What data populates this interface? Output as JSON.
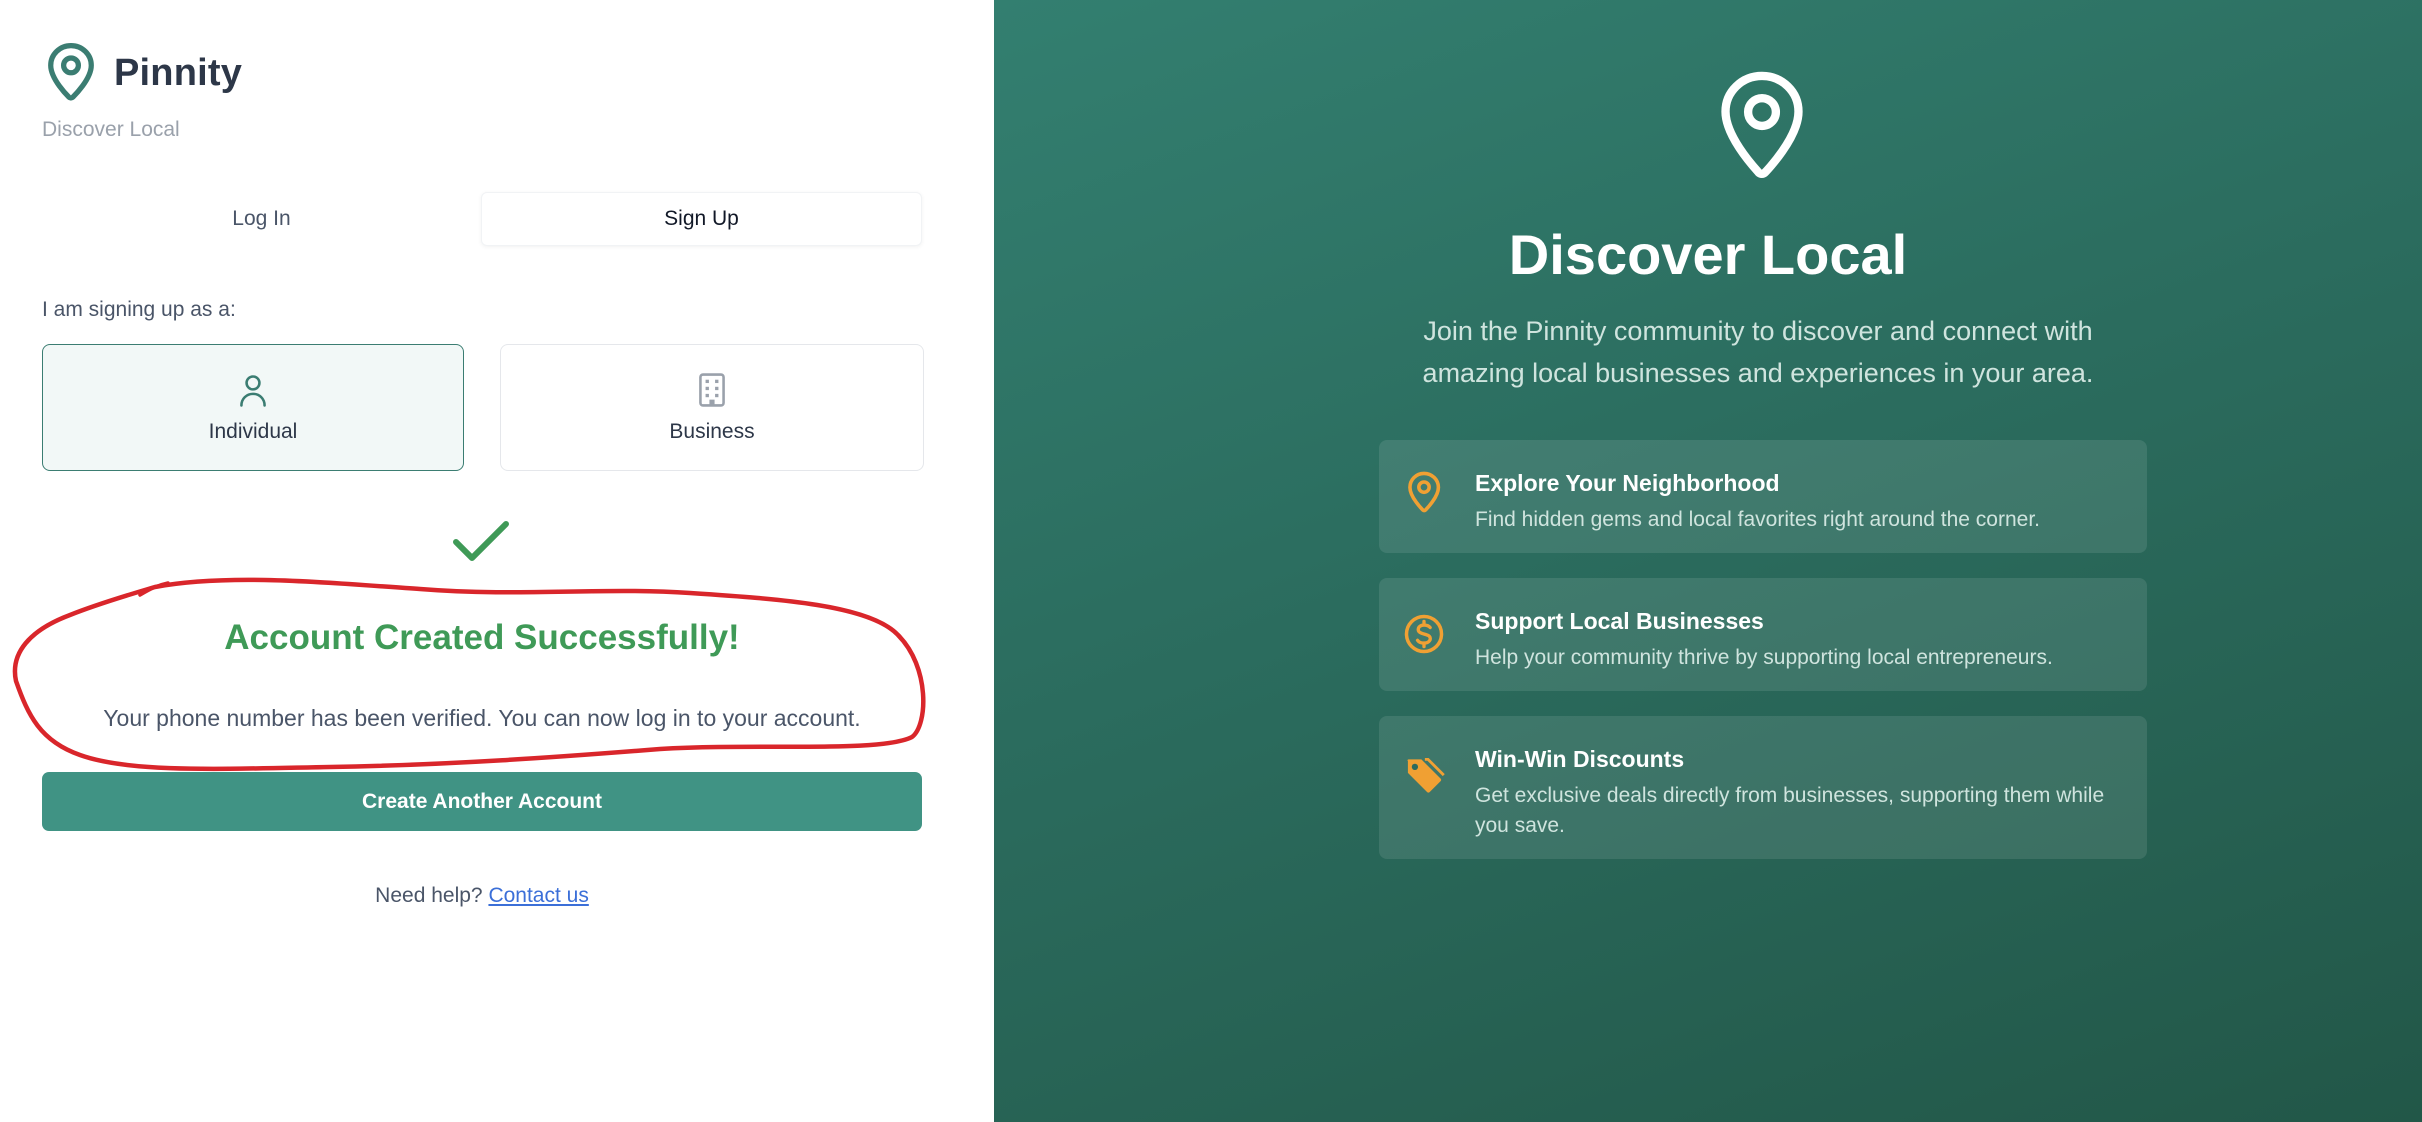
{
  "brand": {
    "name": "Pinnity",
    "tagline": "Discover Local",
    "icon": "map-pin-icon"
  },
  "tabs": [
    {
      "label": "Log In",
      "active": false
    },
    {
      "label": "Sign Up",
      "active": true
    }
  ],
  "signup": {
    "role_prompt": "I am signing up as a:",
    "roles": [
      {
        "label": "Individual",
        "icon": "user-icon",
        "selected": true
      },
      {
        "label": "Business",
        "icon": "building-icon",
        "selected": false
      }
    ]
  },
  "success": {
    "icon": "checkmark-icon",
    "title": "Account Created Successfully!",
    "message": "Your phone number has been verified. You can now log in to your account."
  },
  "actions": {
    "create_another_label": "Create Another Account"
  },
  "help": {
    "prompt": "Need help?",
    "link_label": "Contact us"
  },
  "hero": {
    "icon": "map-pin-icon",
    "title": "Discover Local",
    "description": "Join the Pinnity community to discover and connect with amazing local businesses and experiences in your area.",
    "features": [
      {
        "icon": "map-pin-icon",
        "title": "Explore Your Neighborhood",
        "description": "Find hidden gems and local favorites right around the corner."
      },
      {
        "icon": "dollar-circle-icon",
        "title": "Support Local Businesses",
        "description": "Help your community thrive by supporting local entrepreneurs."
      },
      {
        "icon": "tag-icon",
        "title": "Win-Win Discounts",
        "description": "Get exclusive deals directly from businesses, supporting them while you save."
      }
    ]
  },
  "colors": {
    "accent": "#409384",
    "brand_pin": "#3b7d72",
    "success": "#3f9a57",
    "annotation": "#d9262b",
    "feature_icon": "#f0a033",
    "panel_gradient_start": "#337f70",
    "panel_gradient_end": "#225748",
    "link": "#3b6fd8"
  }
}
